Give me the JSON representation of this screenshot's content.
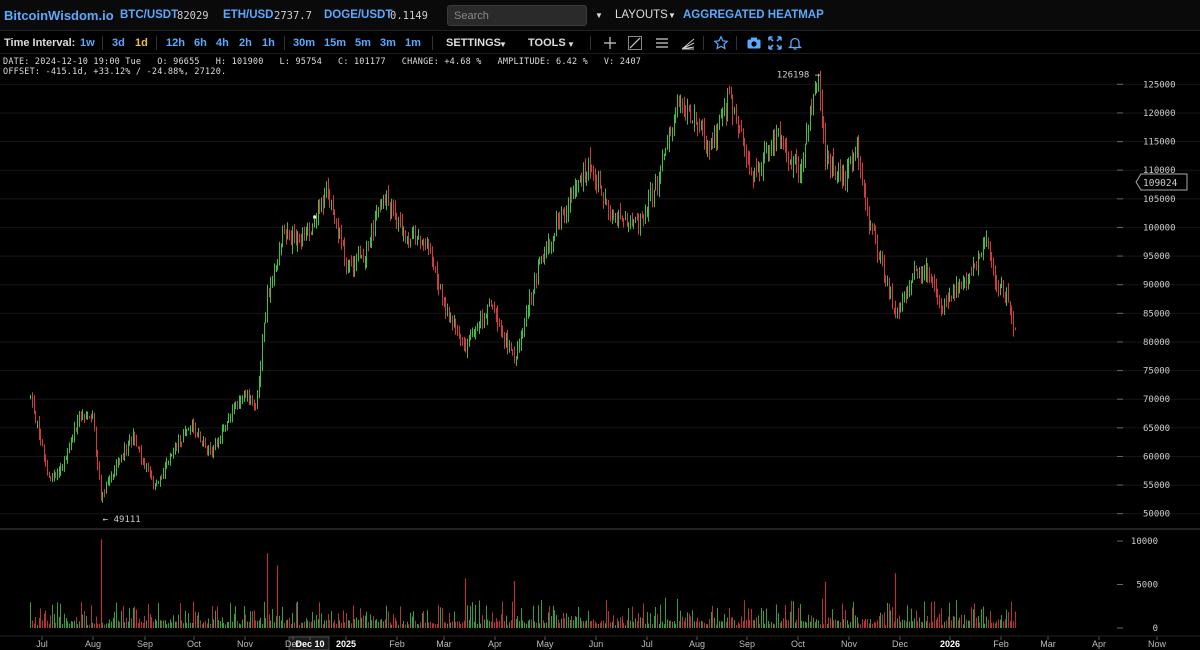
{
  "topbar": {
    "logo": "BitcoinWisdom.io",
    "tickers": [
      {
        "symbol": "BTC/USDT",
        "price": "82029"
      },
      {
        "symbol": "ETH/USD",
        "price": "2737.7"
      },
      {
        "symbol": "DOGE/USDT",
        "price": "0.1149"
      }
    ],
    "search_placeholder": "Search",
    "layouts_label": "LAYOUTS",
    "heatmap_label": "AGGREGATED HEATMAP"
  },
  "toolbar": {
    "time_interval_label": "Time Interval:",
    "intervals": [
      "1w",
      "3d",
      "1d",
      "12h",
      "6h",
      "4h",
      "2h",
      "1h",
      "30m",
      "15m",
      "5m",
      "3m",
      "1m"
    ],
    "active_interval": "1d",
    "settings_label": "SETTINGS",
    "tools_label": "TOOLS",
    "icons": [
      "crosshair-icon",
      "trendline-icon",
      "horizontal-lines-icon",
      "fib-fan-icon",
      "star-icon",
      "camera-icon",
      "fullscreen-icon",
      "alert-bell-icon"
    ]
  },
  "info": {
    "line1": "DATE: 2024-12-10 19:00 Tue   O: 96655   H: 101900   L: 95754   C: 101177   CHANGE: +4.68 %   AMPLITUDE: 6.42 %   V: 2407",
    "line2": "OFFSET: -415.1d, +33.12% / -24.88%, 27120."
  },
  "chart_data": {
    "type": "candlestick",
    "instrument": "BTC/USDT",
    "interval": "1d",
    "price_axis": {
      "ticks": [
        125000,
        120000,
        115000,
        110000,
        105000,
        100000,
        95000,
        90000,
        85000,
        80000,
        75000,
        70000,
        65000,
        60000,
        55000,
        50000
      ],
      "range": [
        47500,
        127500
      ]
    },
    "volume_axis": {
      "ticks": [
        10000,
        5000,
        0
      ],
      "range": [
        0,
        10000
      ]
    },
    "current_price_label": "109024",
    "high_marker": {
      "label": "126198 →",
      "value": 126198
    },
    "low_marker": {
      "label": "← 49111",
      "value": 49111
    },
    "x_axis_labels": [
      "Jul",
      "Aug",
      "Sep",
      "Oct",
      "Nov",
      "Dec",
      "Dec 10",
      "2025",
      "Feb",
      "Mar",
      "Apr",
      "May",
      "Jun",
      "Jul",
      "Aug",
      "Sep",
      "Oct",
      "Nov",
      "Dec",
      "2026",
      "Feb",
      "Mar",
      "Apr",
      "Now"
    ],
    "price_path": [
      [
        "2024-06-24",
        70500
      ],
      [
        "2024-07-05",
        56500
      ],
      [
        "2024-07-12",
        57500
      ],
      [
        "2024-07-22",
        66500
      ],
      [
        "2024-07-31",
        67000
      ],
      [
        "2024-08-05",
        53000
      ],
      [
        "2024-08-14",
        58500
      ],
      [
        "2024-08-24",
        63500
      ],
      [
        "2024-09-06",
        54500
      ],
      [
        "2024-09-20",
        62500
      ],
      [
        "2024-09-28",
        65500
      ],
      [
        "2024-10-10",
        60500
      ],
      [
        "2024-10-21",
        67500
      ],
      [
        "2024-10-29",
        71000
      ],
      [
        "2024-11-05",
        68500
      ],
      [
        "2024-11-12",
        88000
      ],
      [
        "2024-11-22",
        99000
      ],
      [
        "2024-12-02",
        97000
      ],
      [
        "2024-12-10",
        101177
      ],
      [
        "2024-12-17",
        106500
      ],
      [
        "2024-12-30",
        93000
      ],
      [
        "2025-01-08",
        94500
      ],
      [
        "2025-01-20",
        106000
      ],
      [
        "2025-02-03",
        98000
      ],
      [
        "2025-02-15",
        97000
      ],
      [
        "2025-02-28",
        84000
      ],
      [
        "2025-03-10",
        79000
      ],
      [
        "2025-03-25",
        87000
      ],
      [
        "2025-04-08",
        76500
      ],
      [
        "2025-04-22",
        93000
      ],
      [
        "2025-05-08",
        103000
      ],
      [
        "2025-05-22",
        111000
      ],
      [
        "2025-06-05",
        101500
      ],
      [
        "2025-06-22",
        101000
      ],
      [
        "2025-07-03",
        109000
      ],
      [
        "2025-07-14",
        121000
      ],
      [
        "2025-07-28",
        118000
      ],
      [
        "2025-08-02",
        113000
      ],
      [
        "2025-08-14",
        123000
      ],
      [
        "2025-08-28",
        109000
      ],
      [
        "2025-09-12",
        116000
      ],
      [
        "2025-09-25",
        109000
      ],
      [
        "2025-10-03",
        122500
      ],
      [
        "2025-10-06",
        125500
      ],
      [
        "2025-10-10",
        112000
      ],
      [
        "2025-10-22",
        108000
      ],
      [
        "2025-10-28",
        115000
      ],
      [
        "2025-11-05",
        101500
      ],
      [
        "2025-11-20",
        86000
      ],
      [
        "2025-11-21",
        84500
      ],
      [
        "2025-12-02",
        91500
      ],
      [
        "2025-12-10",
        92500
      ],
      [
        "2025-12-18",
        86000
      ],
      [
        "2026-01-06",
        92500
      ],
      [
        "2026-01-14",
        97000
      ],
      [
        "2026-01-20",
        90000
      ],
      [
        "2026-01-26",
        88000
      ],
      [
        "2026-01-31",
        82029
      ]
    ]
  }
}
